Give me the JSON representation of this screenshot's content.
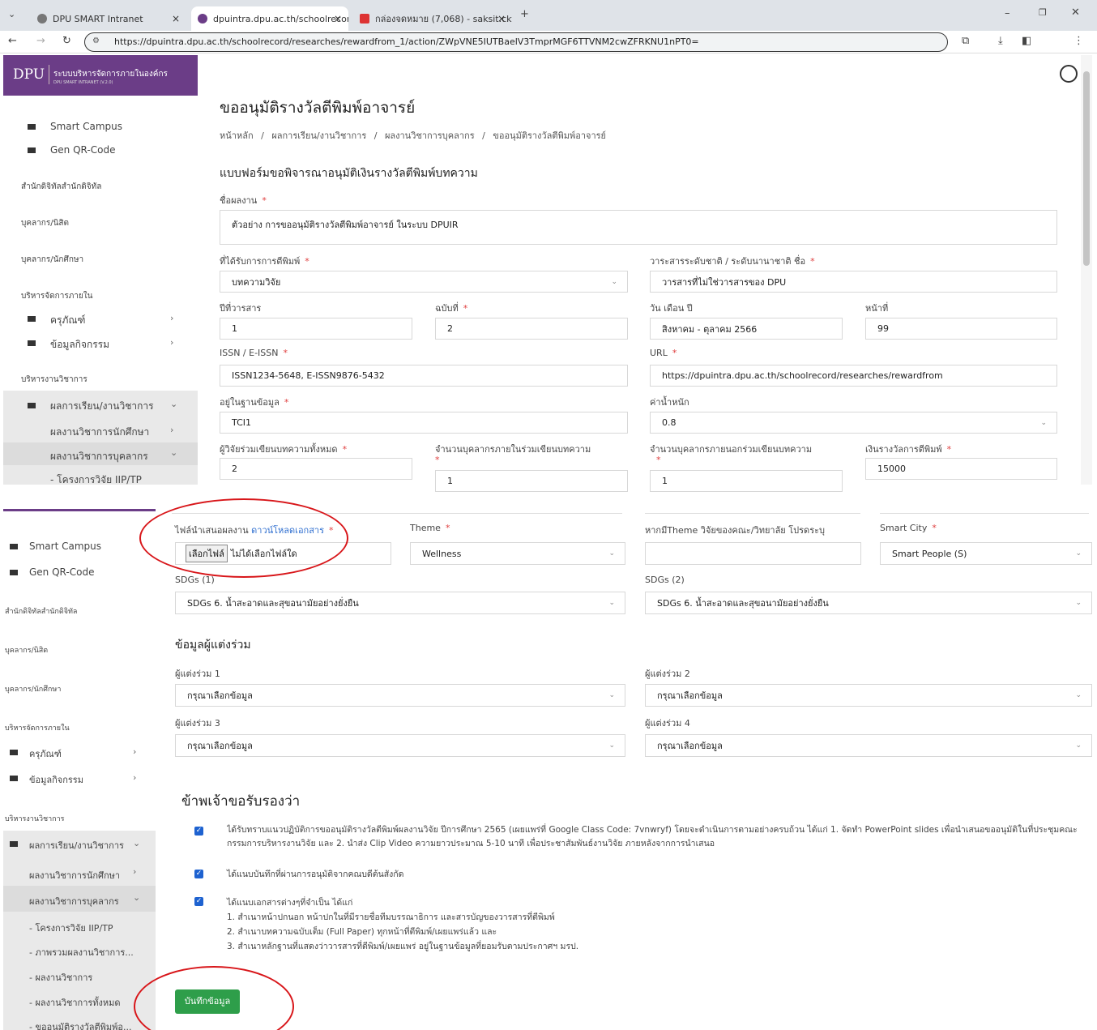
{
  "browser": {
    "tabs": [
      {
        "title": "DPU SMART Intranet"
      },
      {
        "title": "dpuintra.dpu.ac.th/schoolrecor"
      },
      {
        "title": "กล่องจดหมาย (7,068) - saksit.ckt"
      }
    ],
    "url": "https://dpuintra.dpu.ac.th/schoolrecord/researches/rewardfrom_1/action/ZWpVNE5IUTBaelV3TmprMGF6TTVNM2cwZFRKNU1nPT0="
  },
  "brand": {
    "logo": "DPU",
    "system_name": "ระบบบริหารจัดการภายในองค์กร",
    "system_sub": "DPU SMART INTRANET (V.2.0)"
  },
  "sidebar_top": {
    "items": [
      {
        "label": "Smart Campus"
      },
      {
        "label": "Gen QR-Code"
      }
    ],
    "sections": [
      {
        "label": "สำนักดิจิทัลสำนักดิจิทัล"
      },
      {
        "label": "บุคลากร/นิสิต"
      },
      {
        "label": "บุคลากร/นักศึกษา"
      },
      {
        "label": "บริหารจัดการภายใน"
      }
    ],
    "internal": [
      {
        "label": "ครุภัณฑ์"
      },
      {
        "label": "ข้อมูลกิจกรรม"
      }
    ],
    "academic_section": "บริหารงานวิชาการ",
    "academic_menu": "ผลการเรียน/งานวิชาการ",
    "sub": [
      {
        "label": "ผลงานวิชาการนักศึกษา"
      },
      {
        "label": "ผลงานวิชาการบุคลากร"
      },
      {
        "label": "- โครงการวิจัย IIP/TP"
      }
    ]
  },
  "sidebar_bottom": {
    "items": [
      {
        "label": "Smart Campus"
      },
      {
        "label": "Gen QR-Code"
      }
    ],
    "sections": [
      {
        "label": "สำนักดิจิทัลสำนักดิจิทัล"
      },
      {
        "label": "บุคลากร/นิสิต"
      },
      {
        "label": "บุคลากร/นักศึกษา"
      },
      {
        "label": "บริหารจัดการภายใน"
      }
    ],
    "internal": [
      {
        "label": "ครุภัณฑ์"
      },
      {
        "label": "ข้อมูลกิจกรรม"
      }
    ],
    "academic_section": "บริหารงานวิชาการ",
    "academic_menu": "ผลการเรียน/งานวิชาการ",
    "sub": [
      {
        "label": "ผลงานวิชาการนักศึกษา"
      },
      {
        "label": "ผลงานวิชาการบุคลากร"
      },
      {
        "label": "- โครงการวิจัย IIP/TP"
      },
      {
        "label": "- ภาพรวมผลงานวิชาการ..."
      },
      {
        "label": "- ผลงานวิชาการ"
      },
      {
        "label": "- ผลงานวิชาการทั้งหมด"
      },
      {
        "label": "- ขออนุมัติรางวัลตีพิมพ์อ..."
      }
    ]
  },
  "page": {
    "title": "ขออนุมัติรางวัลตีพิมพ์อาจารย์",
    "breadcrumb": [
      "หน้าหลัก",
      "/",
      "ผลการเรียน/งานวิชาการ",
      "/",
      "ผลงานวิชาการบุคลากร",
      "/",
      "ขออนุมัติรางวัลตีพิมพ์อาจารย์"
    ],
    "form_title": "แบบฟอร์มขอพิจารณาอนุมัติเงินรางวัลตีพิมพ์บทความ"
  },
  "form": {
    "work_name": {
      "label": "ชื่อผลงาน",
      "value": "ตัวอย่าง การขออนุมัติรางวัลตีพิมพ์อาจารย์ ในระบบ DPUIR"
    },
    "published_in": {
      "label": "ที่ได้รับการการตีพิมพ์",
      "value": "บทความวิจัย"
    },
    "journal": {
      "label": "วาระสารระดับชาติ / ระดับนานาชาติ ชื่อ",
      "value": "วารสารที่ไม่ใช่วารสารของ DPU"
    },
    "year": {
      "label": "ปีที่วารสาร",
      "value": "1"
    },
    "issue": {
      "label": "ฉบับที่",
      "value": "2"
    },
    "date": {
      "label": "วัน เดือน ปี",
      "value": "สิงหาคม - ตุลาคม 2566"
    },
    "page": {
      "label": "หน้าที่",
      "value": "99"
    },
    "issn": {
      "label": "ISSN / E-ISSN",
      "value": "ISSN1234-5648, E-ISSN9876-5432"
    },
    "url": {
      "label": "URL",
      "value": "https://dpuintra.dpu.ac.th/schoolrecord/researches/rewardfrom"
    },
    "database": {
      "label": "อยู่ในฐานข้อมูล",
      "value": "TCI1"
    },
    "weight": {
      "label": "ค่าน้ำหนัก",
      "value": "0.8"
    },
    "total_authors": {
      "label": "ผู้วิจัยร่วมเขียนบทความทั้งหมด",
      "value": "2"
    },
    "internal_authors": {
      "label": "จำนวนบุคลากรภายในร่วมเขียนบทความ",
      "value": "1"
    },
    "external_authors": {
      "label": "จำนวนบุคลากรภายนอกร่วมเขียนบทความ",
      "value": "1"
    },
    "reward": {
      "label": "เงินรางวัลการตีพิมพ์",
      "value": "15000"
    },
    "file": {
      "label": "ไฟล์นำเสนอผลงาน",
      "link": "ดาวน์โหลดเอกสาร",
      "button": "เลือกไฟล์",
      "status": "ไม่ได้เลือกไฟล์ใด"
    },
    "theme": {
      "label": "Theme",
      "value": "Wellness"
    },
    "theme_other": {
      "label": "หากมีTheme วิจัยของคณะ/วิทยาลัย โปรดระบุ",
      "value": ""
    },
    "smart_city": {
      "label": "Smart City",
      "value": "Smart People (S)"
    },
    "sdg1": {
      "label": "SDGs (1)",
      "value": "SDGs 6. น้ำสะอาดและสุขอนามัยอย่างยั่งยืน"
    },
    "sdg2": {
      "label": "SDGs (2)",
      "value": "SDGs 6. น้ำสะอาดและสุขอนามัยอย่างยั่งยืน"
    },
    "coauthor_title": "ข้อมูลผู้แต่งร่วม",
    "coauthors": [
      {
        "label": "ผู้แต่งร่วม 1",
        "value": "กรุณาเลือกข้อมูล"
      },
      {
        "label": "ผู้แต่งร่วม 2",
        "value": "กรุณาเลือกข้อมูล"
      },
      {
        "label": "ผู้แต่งร่วม 3",
        "value": "กรุณาเลือกข้อมูล"
      },
      {
        "label": "ผู้แต่งร่วม 4",
        "value": "กรุณาเลือกข้อมูล"
      }
    ],
    "certify_title": "ข้าพเจ้าขอรับรองว่า",
    "certify": [
      {
        "line1": "ได้รับทราบแนวปฏิบัติการขออนุมัติรางวัลตีพิมพ์ผลงานวิจัย ปีการศึกษา 2565 (เผยแพร่ที่ Google Class Code: 7vnwryf) โดยจะดำเนินการตามอย่างครบถ้วน ได้แก่ 1. จัดทำ PowerPoint slides เพื่อนำเสนอขออนุมัติในที่ประชุมคณะ",
        "line2": "กรรมการบริหารงานวิจัย และ 2. นำส่ง Clip Video ความยาวประมาณ 5-10 นาที เพื่อประชาสัมพันธ์งานวิจัย ภายหลังจากการนำเสนอ"
      },
      {
        "line1": "ได้แนบบันทึกที่ผ่านการอนุมัติจากคณบดีต้นสังกัด"
      },
      {
        "line1": "ได้แนบเอกสารต่างๆที่จำเป็น ได้แก่",
        "line2": "1. สำเนาหน้าปกนอก หน้าปกในที่มีรายชื่อทีมบรรณาธิการ และสารบัญของวารสารที่ตีพิมพ์",
        "line3": "2. สำเนาบทความฉบับเต็ม (Full Paper) ทุกหน้าที่ตีพิมพ์/เผยแพร่แล้ว และ",
        "line4": "3. สำเนาหลักฐานที่แสดงว่าวารสารที่ตีพิมพ์/เผยแพร่ อยู่ในฐานข้อมูลที่ยอมรับตามประกาศฯ มรป."
      }
    ],
    "submit": "บันทึกข้อมูล"
  },
  "colors": {
    "brand_purple": "#6b3d87",
    "submit_green": "#2e9e4a",
    "annotation_red": "#d8161a"
  }
}
